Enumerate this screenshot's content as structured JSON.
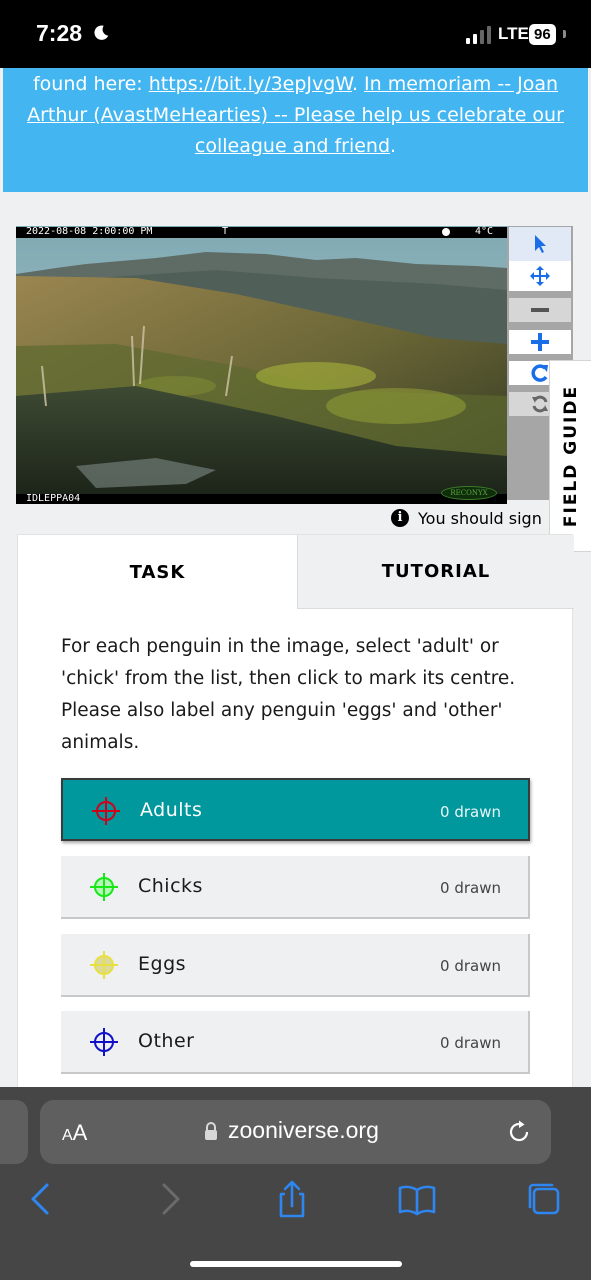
{
  "status_bar": {
    "time": "7:28",
    "network": "LTE",
    "battery": "96",
    "icons": [
      "moon-icon",
      "signal-bars-icon"
    ]
  },
  "announcement": {
    "line1_tail": "found here: ",
    "link_url": "https://bit.ly/3epJvgW",
    "period": ".",
    "memoriam_link": "In memoriam -- Joan Arthur (AvastMeHearties) -- Please help us celebrate our colleague and friend",
    "end": ".",
    "background": "#43b6f2"
  },
  "subject": {
    "camera_timestamp": "2022-08-08 2:00:00 PM",
    "camera_flag": "T",
    "camera_temp": "4°C",
    "camera_id": "IDLEPPA04",
    "camera_brand": "RECONYX"
  },
  "toolbar": {
    "tools": [
      "pointer-icon",
      "move-icon",
      "zoom-out-icon",
      "zoom-in-icon",
      "rotate-icon",
      "reset-icon"
    ]
  },
  "field_guide": {
    "label": "FIELD GUIDE"
  },
  "signin_notice": {
    "text": "You should sign",
    "icon": "info-icon"
  },
  "task_panel": {
    "tabs": [
      {
        "label": "TASK",
        "active": true
      },
      {
        "label": "TUTORIAL",
        "active": false
      }
    ],
    "instructions": "For each penguin in the image, select 'adult' or 'chick' from the list, then click to mark its centre. Please also label any penguin 'eggs' and 'other' animals.",
    "tools": [
      {
        "label": "Adults",
        "count": "0 drawn",
        "color": "#d0021b",
        "active": true
      },
      {
        "label": "Chicks",
        "count": "0 drawn",
        "color": "#18e818",
        "active": false
      },
      {
        "label": "Eggs",
        "count": "0 drawn",
        "color": "#e8e040",
        "active": false
      },
      {
        "label": "Other",
        "count": "0 drawn",
        "color": "#1010c8",
        "active": false
      }
    ],
    "accent": "#00979d"
  },
  "browser": {
    "text_size_label": "AA",
    "domain": "zooniverse.org",
    "nav_icons": [
      "back-icon",
      "forward-icon",
      "share-icon",
      "bookmarks-icon",
      "tabs-icon"
    ]
  }
}
